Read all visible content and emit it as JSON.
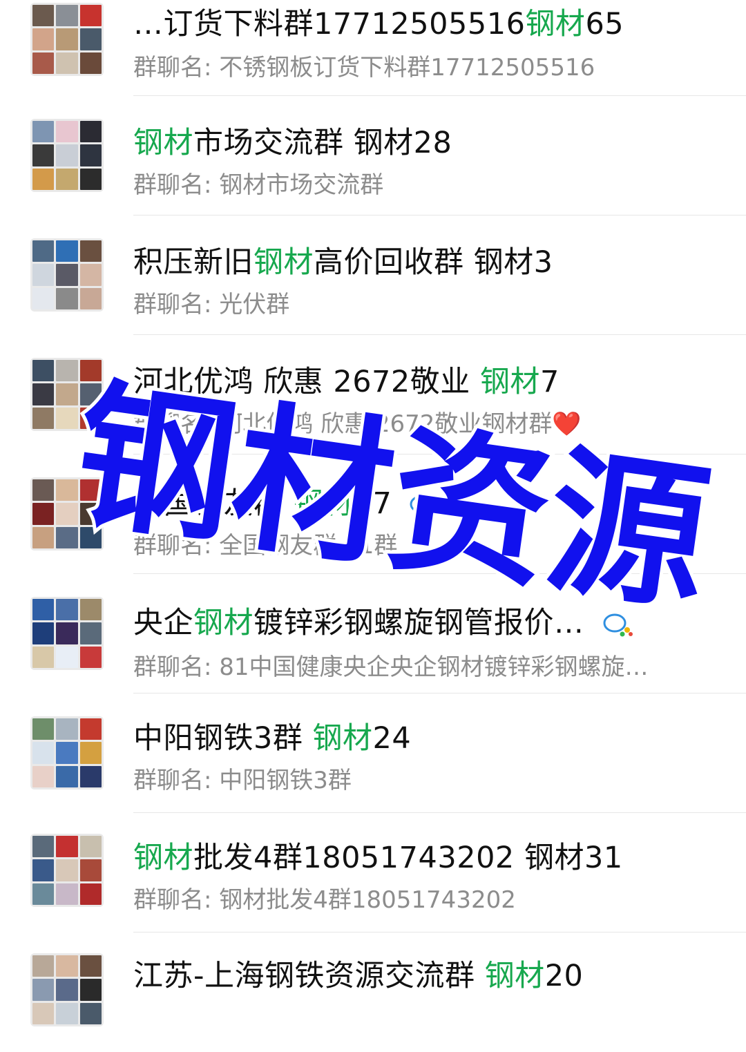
{
  "chats": [
    {
      "title_prefix": "…订货下料群17712505516",
      "title_highlight": "钢材",
      "title_suffix": "65",
      "subtitle": "群聊名: 不锈钢板订货下料群17712505516",
      "avatar_colors": [
        "#6b5a4e",
        "#8a8f96",
        "#c7332e",
        "#d2a48a",
        "#b89a76",
        "#4a5a6a",
        "#a85a4a",
        "#cfc2b0",
        "#6a4a3a"
      ]
    },
    {
      "title_prefix": "",
      "title_highlight": "钢材",
      "title_suffix": "市场交流群 钢材28",
      "subtitle": "群聊名: 钢材市场交流群",
      "avatar_colors": [
        "#7e95b2",
        "#e8c6d0",
        "#2b2b33",
        "#3a3a3a",
        "#c9ced6",
        "#2e3440",
        "#d39a4a",
        "#c4a86e",
        "#2c2c2c"
      ]
    },
    {
      "title_prefix": "积压新旧",
      "title_highlight": "钢材",
      "title_suffix": "高价回收群 钢材3",
      "subtitle": "群聊名: 光伏群",
      "avatar_colors": [
        "#4f6a86",
        "#2f6fb5",
        "#6a5040",
        "#cfd6de",
        "#5a5a66",
        "#d4b6a4",
        "#e4e8ee",
        "#8a8a8a",
        "#c8a896"
      ]
    },
    {
      "title_prefix": "河北优鸿 欣惠 2672敬业 ",
      "title_highlight": "钢材",
      "title_suffix": "7",
      "subtitle": "群聊名: 河北优鸿 欣惠 2672敬业钢材群",
      "subtitle_heart": "❤️",
      "avatar_colors": [
        "#3d4f63",
        "#b8b4ae",
        "#a33a2a",
        "#3a3a44",
        "#c2a88c",
        "#556070",
        "#8f7a64",
        "#e6d8bc",
        "#b23a2e"
      ]
    },
    {
      "title_prefix": "全国钢友群 ",
      "title_highlight": "钢材",
      "title_suffix": "57",
      "subtitle": "群聊名: 全国钢友群 61群",
      "avatar_colors": [
        "#6a5a54",
        "#d9b89a",
        "#b03030",
        "#7a2222",
        "#e4cfc0",
        "#4a3a30",
        "#c7a080",
        "#5a6c86",
        "#2e4a6a"
      ]
    },
    {
      "title_prefix": "央企",
      "title_highlight": "钢材",
      "title_suffix": "镀锌彩钢螺旋钢管报价…",
      "subtitle": "群聊名: 81中国健康央企央企钢材镀锌彩钢螺旋…",
      "avatar_colors": [
        "#2f5fa6",
        "#4a6fa8",
        "#9c8a6a",
        "#1e3e7a",
        "#3a2a5a",
        "#5a6a7a",
        "#d8c8a8",
        "#e8eef6",
        "#c83a3a"
      ]
    },
    {
      "title_prefix": "中阳钢铁3群 ",
      "title_highlight": "钢材",
      "title_suffix": "24",
      "subtitle": "群聊名: 中阳钢铁3群",
      "avatar_colors": [
        "#6e8e6a",
        "#a8b4c0",
        "#c43a2e",
        "#d8e2ec",
        "#4a7ac0",
        "#d4a040",
        "#e8d0c8",
        "#3a6aa8",
        "#2a3a6a"
      ]
    },
    {
      "title_prefix": "",
      "title_highlight": "钢材",
      "title_suffix": "批发4群18051743202 钢材31",
      "subtitle": "群聊名: 钢材批发4群18051743202",
      "avatar_colors": [
        "#5a6a7a",
        "#c43030",
        "#c8bfae",
        "#3a5a8a",
        "#d8c8b8",
        "#a84a3a",
        "#6a8a9a",
        "#c8b8c8",
        "#b02a2a"
      ]
    },
    {
      "title_prefix": "江苏-上海钢铁资源交流群 ",
      "title_highlight": "钢材",
      "title_suffix": "20",
      "subtitle": "",
      "avatar_colors": [
        "#b8a898",
        "#d8b8a0",
        "#6a5040",
        "#8a9ab0",
        "#5a6a8a",
        "#2a2a2a",
        "#d8c8b8",
        "#c8d0d8",
        "#4a5a6a"
      ]
    }
  ],
  "overlay": {
    "text": "钢材资源",
    "fill_color": "#1111ee",
    "stroke_color": "#ffffff"
  },
  "colors": {
    "highlight": "#17a84e",
    "title": "#111111",
    "subtitle": "#8c8c8c"
  }
}
